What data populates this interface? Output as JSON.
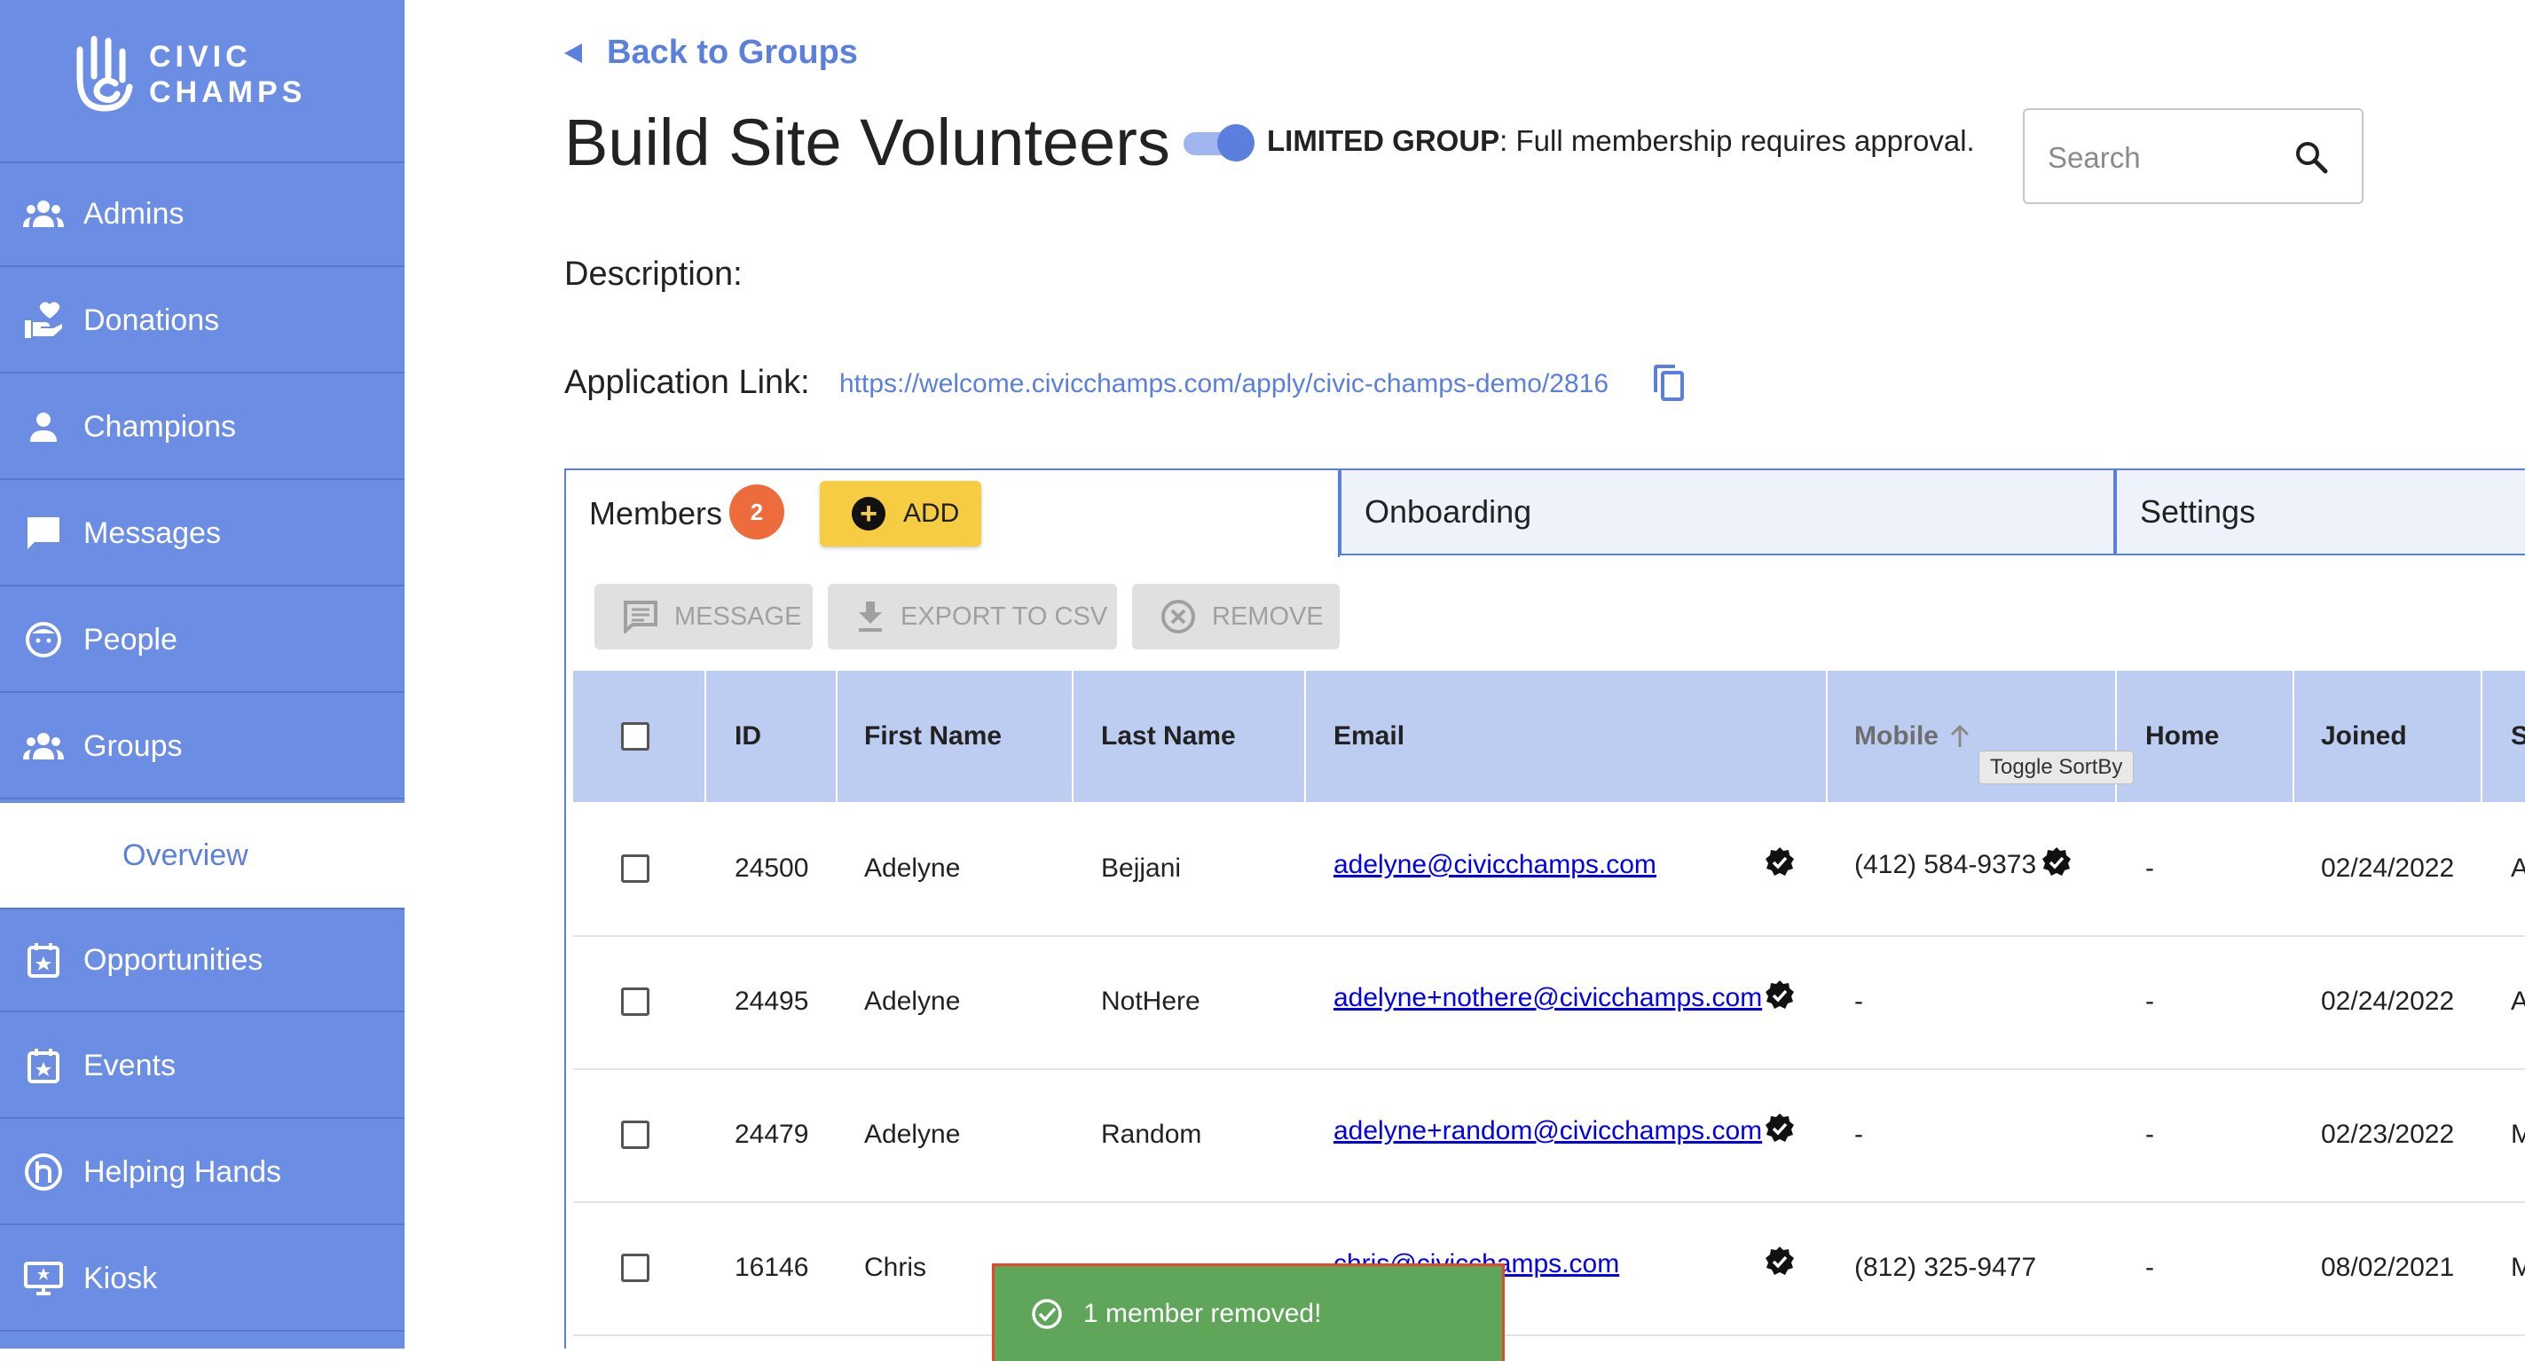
{
  "brand": {
    "logo_line1": "CIVIC",
    "logo_line2": "CHAMPS"
  },
  "sidebar": {
    "items": [
      {
        "label": "Admins",
        "icon": "admins-icon"
      },
      {
        "label": "Donations",
        "icon": "donations-icon"
      },
      {
        "label": "Champions",
        "icon": "champions-icon"
      },
      {
        "label": "Messages",
        "icon": "messages-icon"
      },
      {
        "label": "People",
        "icon": "people-icon"
      },
      {
        "label": "Groups",
        "icon": "groups-icon"
      },
      {
        "label": "Overview",
        "icon": ""
      },
      {
        "label": "Opportunities",
        "icon": "opportunities-icon"
      },
      {
        "label": "Events",
        "icon": "events-icon"
      },
      {
        "label": "Helping Hands",
        "icon": "helping-hands-icon"
      },
      {
        "label": "Kiosk",
        "icon": "kiosk-icon"
      }
    ]
  },
  "header": {
    "back_label": "Back to Groups",
    "title": "Build Site Volunteers",
    "limited_label": "LIMITED GROUP",
    "limited_desc": ": Full membership requires approval.",
    "limited_toggle_on": true
  },
  "search": {
    "placeholder": "Search"
  },
  "description_label": "Description:",
  "application": {
    "label": "Application Link:",
    "url": "https://welcome.civicchamps.com/apply/civic-champs-demo/2816"
  },
  "tabs": {
    "members": "Members",
    "members_count": "2",
    "add_label": "ADD",
    "onboarding": "Onboarding",
    "settings": "Settings"
  },
  "toolbar": {
    "message": "MESSAGE",
    "export": "EXPORT TO CSV",
    "remove": "REMOVE"
  },
  "table": {
    "headers": {
      "id": "ID",
      "first": "First Name",
      "last": "Last Name",
      "email": "Email",
      "mobile": "Mobile",
      "home": "Home",
      "joined": "Joined",
      "status": "S"
    },
    "tooltip": "Toggle SortBy",
    "rows": [
      {
        "id": "24500",
        "first": "Adelyne",
        "last": "Bejjani",
        "email": "adelyne@civicchamps.com",
        "mobile": "(412) 584-9373",
        "home": "-",
        "joined": "02/24/2022",
        "status": "A"
      },
      {
        "id": "24495",
        "first": "Adelyne",
        "last": "NotHere",
        "email": "adelyne+nothere@civicchamps.com",
        "mobile": "-",
        "home": "-",
        "joined": "02/24/2022",
        "status": "A"
      },
      {
        "id": "24479",
        "first": "Adelyne",
        "last": "Random",
        "email": "adelyne+random@civicchamps.com",
        "mobile": "-",
        "home": "-",
        "joined": "02/23/2022",
        "status": "M"
      },
      {
        "id": "16146",
        "first": "Chris",
        "last": "",
        "email": "chris@civicchamps.com",
        "mobile": "(812) 325-9477",
        "home": "-",
        "joined": "08/02/2021",
        "status": "M"
      }
    ]
  },
  "snackbar": {
    "message": "1 member removed!"
  },
  "colors": {
    "sidebar": "#6b8de4",
    "accent": "#5b7fdc",
    "header_row": "#bccdf1",
    "add_button": "#f6cd42",
    "badge": "#ee6b3b",
    "snackbar": "#5fa65a"
  }
}
